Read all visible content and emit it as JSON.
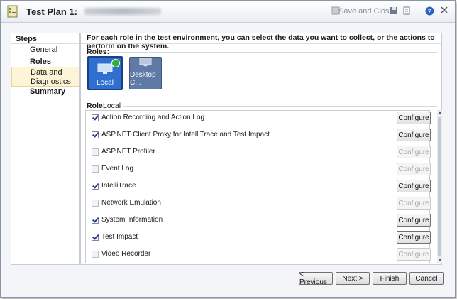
{
  "window": {
    "title": "Test Plan 1:",
    "toolbar": {
      "save_close_label": "Save and Close"
    }
  },
  "steps": {
    "header": "Steps",
    "items": [
      {
        "label": "General",
        "bold": false
      },
      {
        "label": "Roles",
        "bold": true
      },
      {
        "label": "Data and Diagnostics",
        "bold": false,
        "selected": true
      },
      {
        "label": "Summary",
        "bold": true
      }
    ]
  },
  "content": {
    "description": "For each role in the test environment, you can select the data you want to collect, or the actions to perform on the system.",
    "roles_label": "Roles:",
    "roles": [
      {
        "label": "Local",
        "selected": true
      },
      {
        "label": "Desktop C...",
        "selected": false
      }
    ],
    "role_prefix": "Role:",
    "role_value": "Local",
    "adapters": [
      {
        "name": "Action Recording and Action Log",
        "checked": true,
        "configure": "Configure",
        "configure_enabled": true
      },
      {
        "name": "ASP.NET Client Proxy for IntelliTrace and Test Impact",
        "checked": true,
        "configure": "Configure",
        "configure_enabled": true
      },
      {
        "name": "ASP.NET Profiler",
        "checked": false,
        "configure": "Configure",
        "configure_enabled": false
      },
      {
        "name": "Event Log",
        "checked": false,
        "configure": "Configure",
        "configure_enabled": false
      },
      {
        "name": "IntelliTrace",
        "checked": true,
        "configure": "Configure",
        "configure_enabled": true
      },
      {
        "name": "Network Emulation",
        "checked": false,
        "configure": "Configure",
        "configure_enabled": false
      },
      {
        "name": "System Information",
        "checked": true,
        "configure": "Configure",
        "configure_enabled": true
      },
      {
        "name": "Test Impact",
        "checked": true,
        "configure": "Configure",
        "configure_enabled": true
      },
      {
        "name": "Video Recorder",
        "checked": false,
        "configure": "Configure",
        "configure_enabled": false
      }
    ]
  },
  "footer": {
    "previous": "< Previous",
    "next": "Next >",
    "finish": "Finish",
    "cancel": "Cancel"
  },
  "colors": {
    "selected_role": "#2f6fd0",
    "unselected_role": "#5f7aa6",
    "step_highlight": "#fdf5d6"
  },
  "icons": [
    "test-plan-icon",
    "save-icon",
    "save-close-icon",
    "refresh-icon",
    "help-icon",
    "close-icon",
    "monitor-icon",
    "check-icon"
  ]
}
